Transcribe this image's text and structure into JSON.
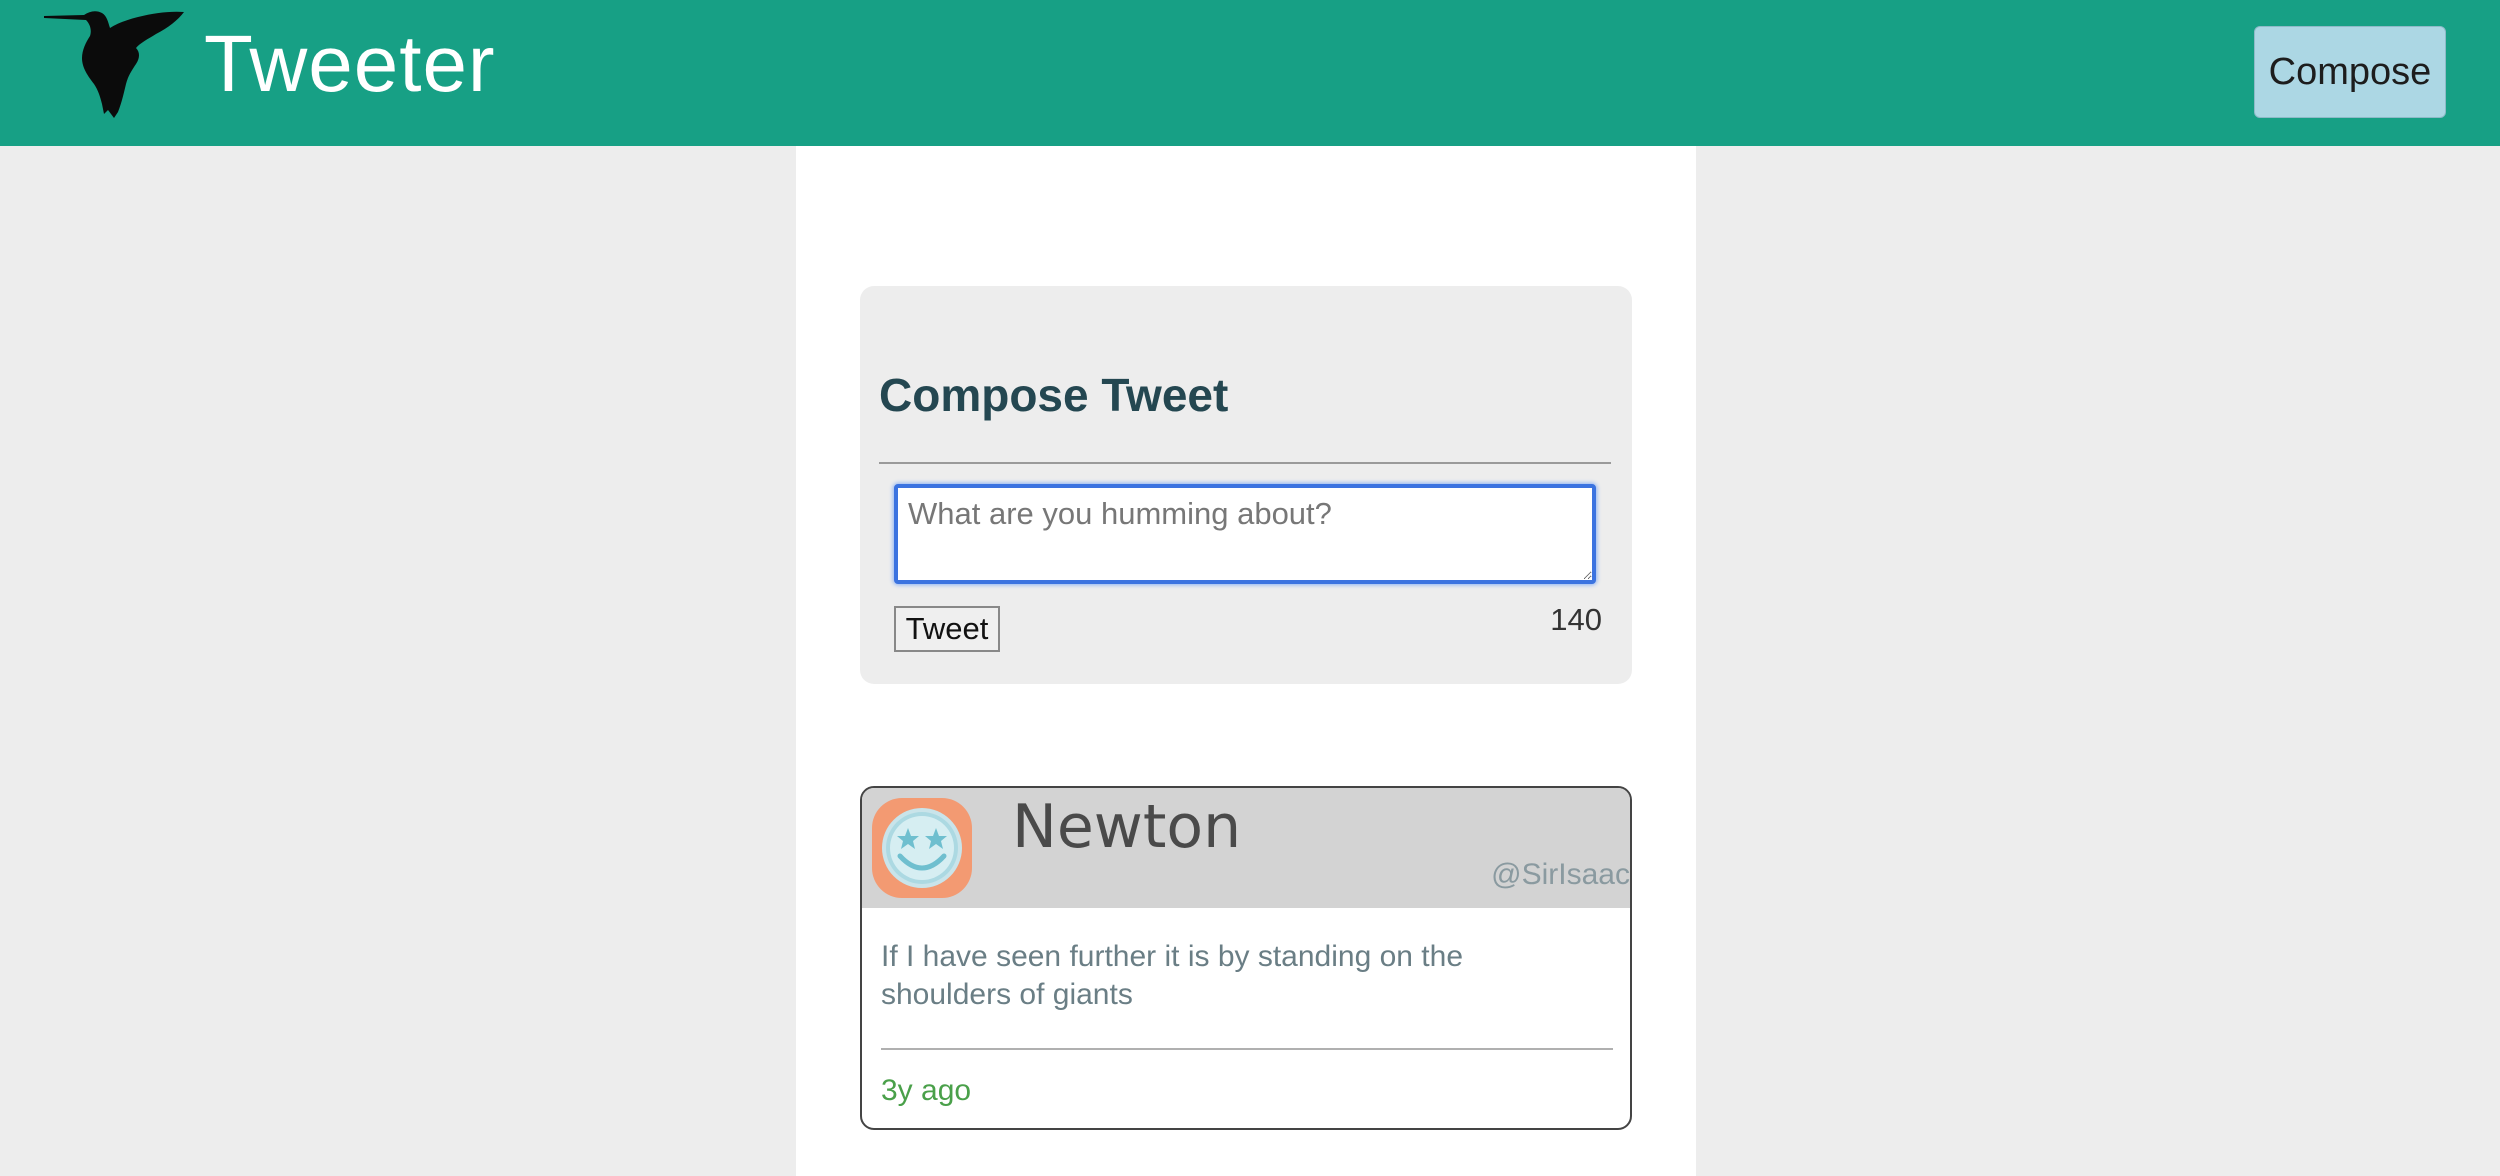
{
  "app": {
    "brand": "Tweeter",
    "compose_button": "Compose"
  },
  "compose": {
    "title": "Compose Tweet",
    "placeholder": "What are you humming about?",
    "value": "",
    "submit_label": "Tweet",
    "char_count": "140"
  },
  "tweets": [
    {
      "name": "Newton",
      "handle": "@SirIsaac",
      "text": "If I have seen further it is by standing on the shoulders of giants",
      "time": "3y ago"
    }
  ],
  "icons": {
    "logo": "hummingbird-icon",
    "avatar": "smiley-star-eyes-icon"
  },
  "colors": {
    "header": "#17a085",
    "compose_button": "#acd7e4",
    "title": "#244751",
    "timestamp": "#4aa04a"
  }
}
